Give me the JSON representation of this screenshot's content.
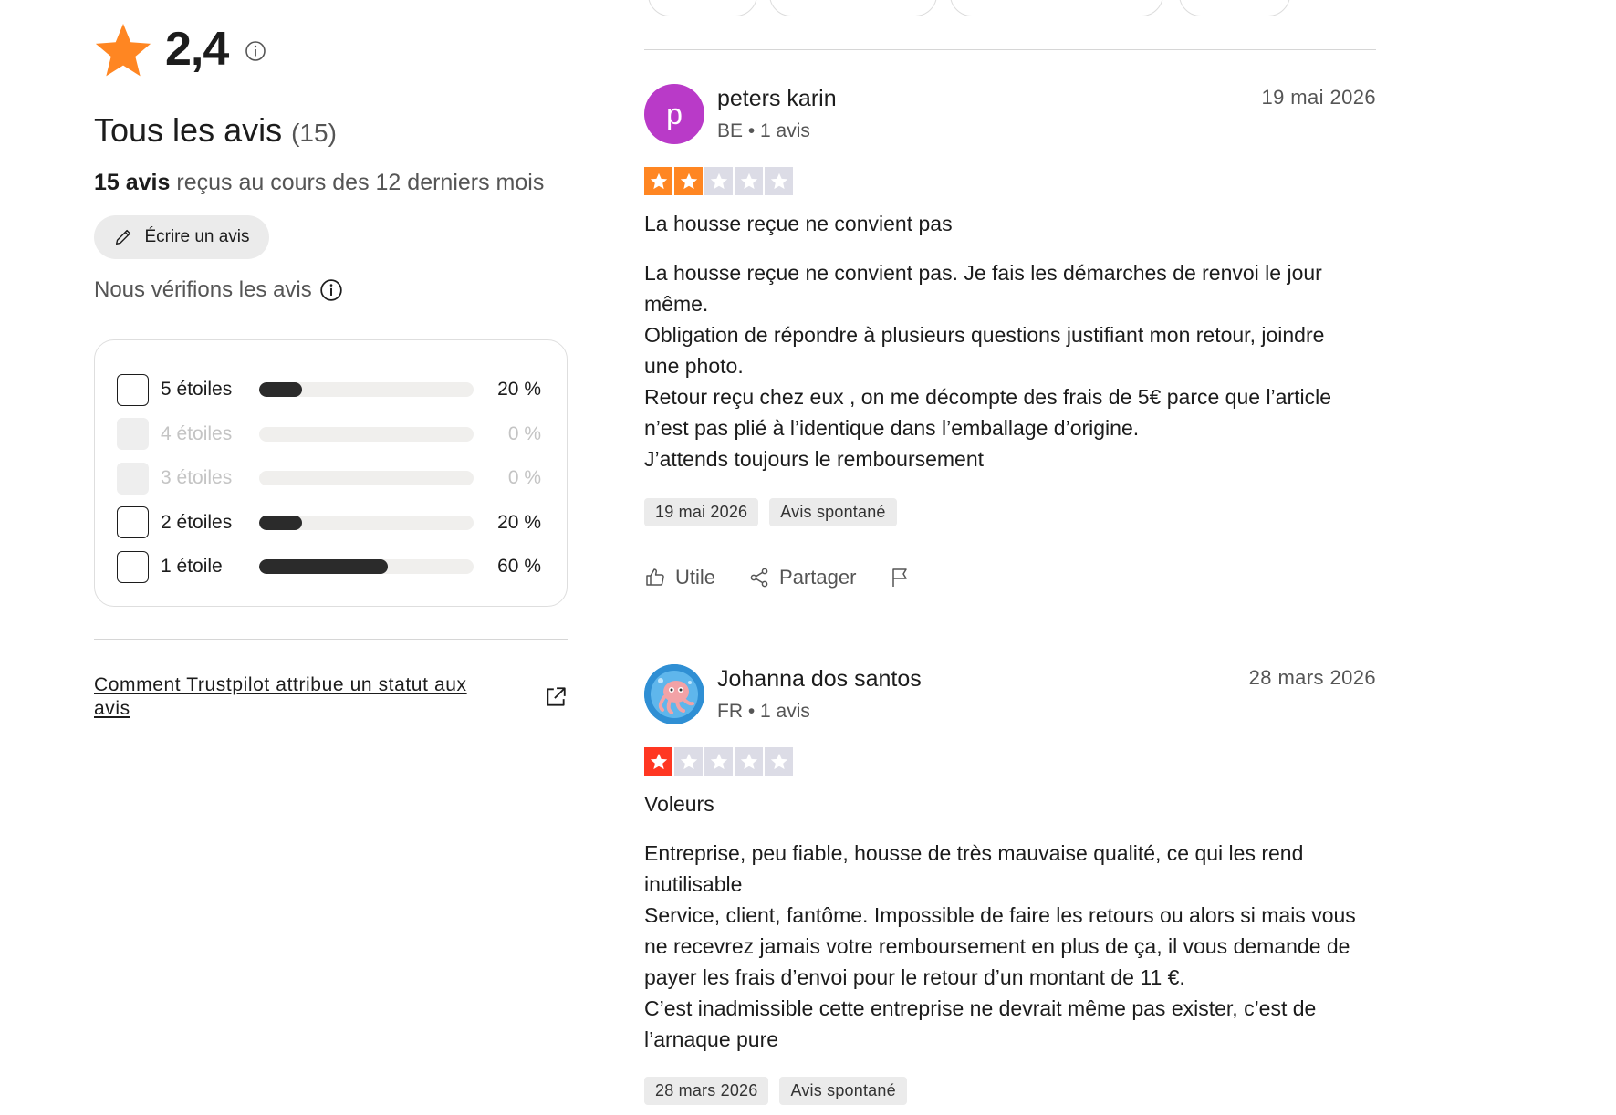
{
  "summary": {
    "score": "2,4",
    "all_reviews_label": "Tous les avis",
    "all_reviews_count": "(15)",
    "received_bold": "15 avis",
    "received_rest": " reçus au cours des 12 derniers mois",
    "write_review": "Écrire un avis",
    "we_verify": "Nous vérifions les avis",
    "how_link": "Comment Trustpilot attribue un statut aux avis"
  },
  "distribution": [
    {
      "label": "5 étoiles",
      "percent": "20 %",
      "fraction": 0.2,
      "enabled": true
    },
    {
      "label": "4 étoiles",
      "percent": "0 %",
      "fraction": 0,
      "enabled": false
    },
    {
      "label": "3 étoiles",
      "percent": "0 %",
      "fraction": 0,
      "enabled": false
    },
    {
      "label": "2 étoiles",
      "percent": "20 %",
      "fraction": 0.2,
      "enabled": true
    },
    {
      "label": "1 étoile",
      "percent": "60 %",
      "fraction": 0.6,
      "enabled": true
    }
  ],
  "reviews": [
    {
      "avatar_letter": "p",
      "name": "peters karin",
      "meta": "BE • 1 avis",
      "date": "19 mai 2026",
      "rating": 2,
      "star_color": "#ff8622",
      "title": "La housse reçue ne convient pas",
      "body": "La housse reçue ne convient pas. Je fais les démarches de renvoi le jour même.\nObligation de répondre à plusieurs questions justifiant mon retour, joindre une photo.\nRetour reçu chez eux , on me décompte des frais de 5€ parce que l’article n’est pas plié à l’identique dans l’emballage d’origine.\nJ’attends toujours le remboursement",
      "tag_date": "19 mai 2026",
      "tag_type": "Avis spontané",
      "useful": "Utile",
      "share": "Partager"
    },
    {
      "avatar_letter": "",
      "name": "Johanna dos santos",
      "meta": "FR • 1 avis",
      "date": "28 mars 2026",
      "rating": 1,
      "star_color": "#ff3722",
      "title": "Voleurs",
      "body": "Entreprise, peu fiable, housse de très mauvaise qualité, ce qui les rend inutilisable\nService, client, fantôme. Impossible de faire les retours ou alors si mais vous ne recevrez jamais votre remboursement en plus de ça, il vous demande de payer les frais d’envoi pour le retour d’un montant de 11 €.\nC’est inadmissible cette entreprise ne devrait même pas exister, c’est de l’arnaque pure",
      "tag_date": "28 mars 2026",
      "tag_type": "Avis spontané"
    }
  ],
  "colors": {
    "brand_star": "#ff8622",
    "one_star": "#ff3722",
    "empty_star": "#dcdce6",
    "avatar_purple": "#b93ac8"
  }
}
